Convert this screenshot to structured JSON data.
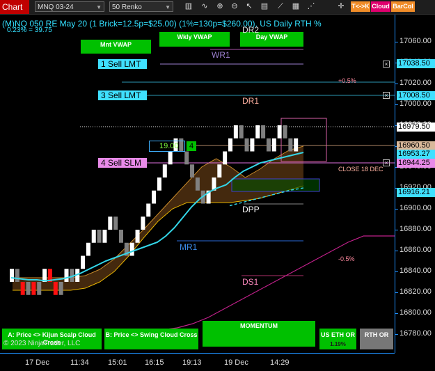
{
  "toolbar": {
    "tab_label": "Chart",
    "instrument": "MNQ 03-24",
    "bar_type": "50 Renko",
    "btn_cross": "T<->K",
    "btn_cloud": "Cloud",
    "btn_barcol": "BarCol"
  },
  "header": {
    "title": "(M)NQ 050 RE May 20 (1 Brick=12.5p=$25.00) (1%=130p=$260.00), US Daily RTH %",
    "subtitle": "0.23% = 39.75"
  },
  "vwap_buttons": {
    "mnt": "Mnt VWAP",
    "wkly": "Wkly VWAP",
    "day": "Day VWAP"
  },
  "levels": {
    "dr2": "DR2",
    "wr1": "WR1",
    "dr1": "DR1",
    "dpp": "DPP",
    "mr1": "MR1",
    "ds1": "DS1",
    "plus_half": "+0.5%",
    "minus_half": "-0.5%",
    "close": "CLOSE 18 DEC"
  },
  "orders": {
    "sell1": "1 Sell LMT",
    "sell3": "3 Sell LMT",
    "sell4": "4 Sell SLM",
    "position_price": "19.00",
    "position_qty": "4"
  },
  "price_axis": {
    "ticks": [
      "17060.00",
      "17040.00",
      "17020.00",
      "17000.00",
      "16980.00",
      "16960.00",
      "16940.00",
      "16920.00",
      "16900.00",
      "16880.00",
      "16860.00",
      "16840.00",
      "16820.00",
      "16800.00",
      "16780.00"
    ],
    "labels": {
      "sell1": "17038.50",
      "sell3": "17008.50",
      "last": "16979.50",
      "p16960": "16960.50",
      "p16953": "16953.27",
      "sell4": "16944.25",
      "p16916": "16916.21"
    }
  },
  "time_axis": [
    "17 Dec",
    "11:34",
    "15:01",
    "16:15",
    "19:13",
    "19 Dec",
    "14:29"
  ],
  "bottom_buttons": {
    "a": "A: Price <> Kijun Scalp Cloud Cross",
    "b": "B: Price <> Swing Cloud Cross",
    "momentum": "MOMENTUM",
    "us_eth": "US ETH OR",
    "us_eth_sub": "1.19%",
    "rth": "RTH OR"
  },
  "copyright": "© 2023 NinjaTrader, LLC",
  "colors": {
    "axis": "#1e90ff",
    "cyan": "#00e5ff",
    "violet": "#e070e0",
    "green": "#00c000",
    "orange": "#f08c28"
  },
  "chart_data": {
    "type": "renko",
    "brick_size": 12.5,
    "ylim": [
      16770,
      17080
    ],
    "bricks": [
      {
        "o": 16830,
        "c": 16842.5,
        "col": "white"
      },
      {
        "o": 16830,
        "c": 16842.5,
        "col": "gray"
      },
      {
        "o": 16830,
        "c": 16817.5,
        "col": "red"
      },
      {
        "o": 16817.5,
        "c": 16830,
        "col": "gray"
      },
      {
        "o": 16830,
        "c": 16817.5,
        "col": "red"
      },
      {
        "o": 16817.5,
        "c": 16830,
        "col": "gray"
      },
      {
        "o": 16830,
        "c": 16842.5,
        "col": "white"
      },
      {
        "o": 16842.5,
        "c": 16830,
        "col": "red"
      },
      {
        "o": 16830,
        "c": 16817.5,
        "col": "red"
      },
      {
        "o": 16817.5,
        "c": 16830,
        "col": "gray"
      },
      {
        "o": 16830,
        "c": 16842.5,
        "col": "white"
      },
      {
        "o": 16842.5,
        "c": 16830,
        "col": "gray"
      },
      {
        "o": 16830,
        "c": 16842.5,
        "col": "white"
      },
      {
        "o": 16842.5,
        "c": 16855,
        "col": "white"
      },
      {
        "o": 16855,
        "c": 16867.5,
        "col": "white"
      },
      {
        "o": 16867.5,
        "c": 16880,
        "col": "white"
      },
      {
        "o": 16880,
        "c": 16867.5,
        "col": "gray"
      },
      {
        "o": 16867.5,
        "c": 16880,
        "col": "white"
      },
      {
        "o": 16880,
        "c": 16892.5,
        "col": "white"
      },
      {
        "o": 16892.5,
        "c": 16880,
        "col": "gray"
      },
      {
        "o": 16880,
        "c": 16867.5,
        "col": "gray"
      },
      {
        "o": 16867.5,
        "c": 16855,
        "col": "gray"
      },
      {
        "o": 16855,
        "c": 16867.5,
        "col": "white"
      },
      {
        "o": 16867.5,
        "c": 16880,
        "col": "white"
      },
      {
        "o": 16880,
        "c": 16892.5,
        "col": "white"
      },
      {
        "o": 16892.5,
        "c": 16905,
        "col": "white"
      },
      {
        "o": 16905,
        "c": 16917.5,
        "col": "white"
      },
      {
        "o": 16917.5,
        "c": 16930,
        "col": "white"
      },
      {
        "o": 16930,
        "c": 16942.5,
        "col": "white"
      },
      {
        "o": 16942.5,
        "c": 16955,
        "col": "white"
      },
      {
        "o": 16955,
        "c": 16967.5,
        "col": "white"
      },
      {
        "o": 16967.5,
        "c": 16955,
        "col": "gray"
      },
      {
        "o": 16955,
        "c": 16942.5,
        "col": "gray"
      },
      {
        "o": 16942.5,
        "c": 16930,
        "col": "gray"
      },
      {
        "o": 16930,
        "c": 16917.5,
        "col": "gray"
      },
      {
        "o": 16917.5,
        "c": 16905,
        "col": "gray"
      },
      {
        "o": 16905,
        "c": 16917.5,
        "col": "white"
      },
      {
        "o": 16917.5,
        "c": 16930,
        "col": "white"
      },
      {
        "o": 16930,
        "c": 16942.5,
        "col": "white"
      },
      {
        "o": 16942.5,
        "c": 16955,
        "col": "white"
      },
      {
        "o": 16955,
        "c": 16967.5,
        "col": "white"
      },
      {
        "o": 16967.5,
        "c": 16980,
        "col": "white"
      },
      {
        "o": 16980,
        "c": 16967.5,
        "col": "gray"
      },
      {
        "o": 16967.5,
        "c": 16955,
        "col": "gray"
      },
      {
        "o": 16955,
        "c": 16967.5,
        "col": "white"
      },
      {
        "o": 16967.5,
        "c": 16980,
        "col": "white"
      },
      {
        "o": 16980,
        "c": 16967.5,
        "col": "gray"
      },
      {
        "o": 16967.5,
        "c": 16955,
        "col": "gray"
      },
      {
        "o": 16955,
        "c": 16967.5,
        "col": "white"
      },
      {
        "o": 16967.5,
        "c": 16980,
        "col": "white"
      },
      {
        "o": 16980,
        "c": 16967.5,
        "col": "gray"
      },
      {
        "o": 16967.5,
        "c": 16955,
        "col": "gray"
      },
      {
        "o": 16955,
        "c": 16967.5,
        "col": "white"
      }
    ],
    "fast_line": [
      16834,
      16833,
      16832,
      16832,
      16831,
      16832,
      16833,
      16835,
      16838,
      16842,
      16846,
      16850,
      16853,
      16856,
      16859,
      16862,
      16865,
      16868,
      16874,
      16882,
      16892,
      16902,
      16910,
      16916,
      16920,
      16923,
      16930,
      16936,
      16940,
      16944,
      16946,
      16948,
      16950,
      16952,
      16954
    ],
    "dashed_line": [
      16903,
      16906,
      16909,
      16912,
      16915,
      16918,
      16920
    ],
    "cloud_upper": [
      16834,
      16834,
      16834,
      16834,
      16834,
      16836,
      16842,
      16852,
      16866,
      16880,
      16895,
      16910,
      16925,
      16940,
      16948,
      16940,
      16930,
      16938,
      16948,
      16956,
      16960
    ],
    "cloud_lower": [
      16822,
      16822,
      16822,
      16822,
      16822,
      16824,
      16830,
      16840,
      16855,
      16872,
      16888,
      16900,
      16906,
      16906,
      16906,
      16906,
      16908,
      16910,
      16914,
      16918,
      16922
    ],
    "ds1_line": [
      16782,
      16784,
      16786,
      16790,
      16796,
      16804,
      16812,
      16820,
      16828,
      16836,
      16844,
      16852,
      16860,
      16868,
      16874,
      16874,
      16874
    ]
  }
}
